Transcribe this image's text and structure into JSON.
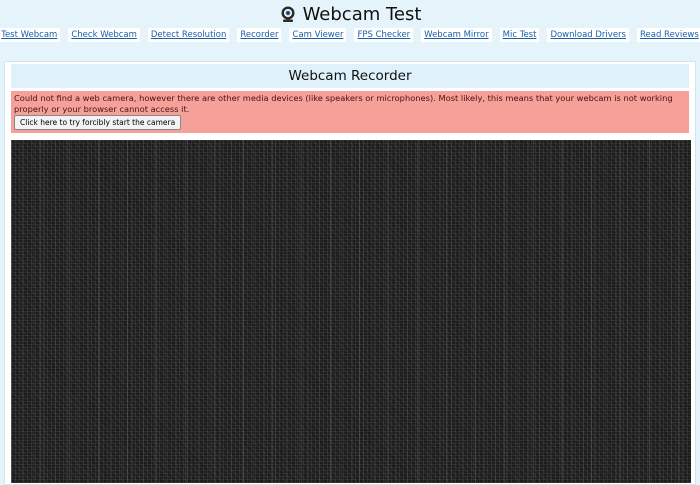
{
  "header": {
    "title": "Webcam Test",
    "logo_icon": "webcam-icon"
  },
  "nav": {
    "items": [
      {
        "label": "Test Webcam"
      },
      {
        "label": "Check Webcam"
      },
      {
        "label": "Detect Resolution"
      },
      {
        "label": "Recorder"
      },
      {
        "label": "Cam Viewer"
      },
      {
        "label": "FPS Checker"
      },
      {
        "label": "Webcam Mirror"
      },
      {
        "label": "Mic Test"
      },
      {
        "label": "Download Drivers"
      },
      {
        "label": "Read Reviews"
      }
    ]
  },
  "panel": {
    "title": "Webcam Recorder",
    "error_message": "Could not find a web camera, however there are other media devices (like speakers or microphones). Most likely, this means that your webcam is not working properly or your browser cannot access it.",
    "force_button_label": "Click here to try forcibly start the camera"
  },
  "colors": {
    "page_bg": "#e5f4fb",
    "error_bg": "#f6a09a",
    "link": "#1a5ea8"
  }
}
